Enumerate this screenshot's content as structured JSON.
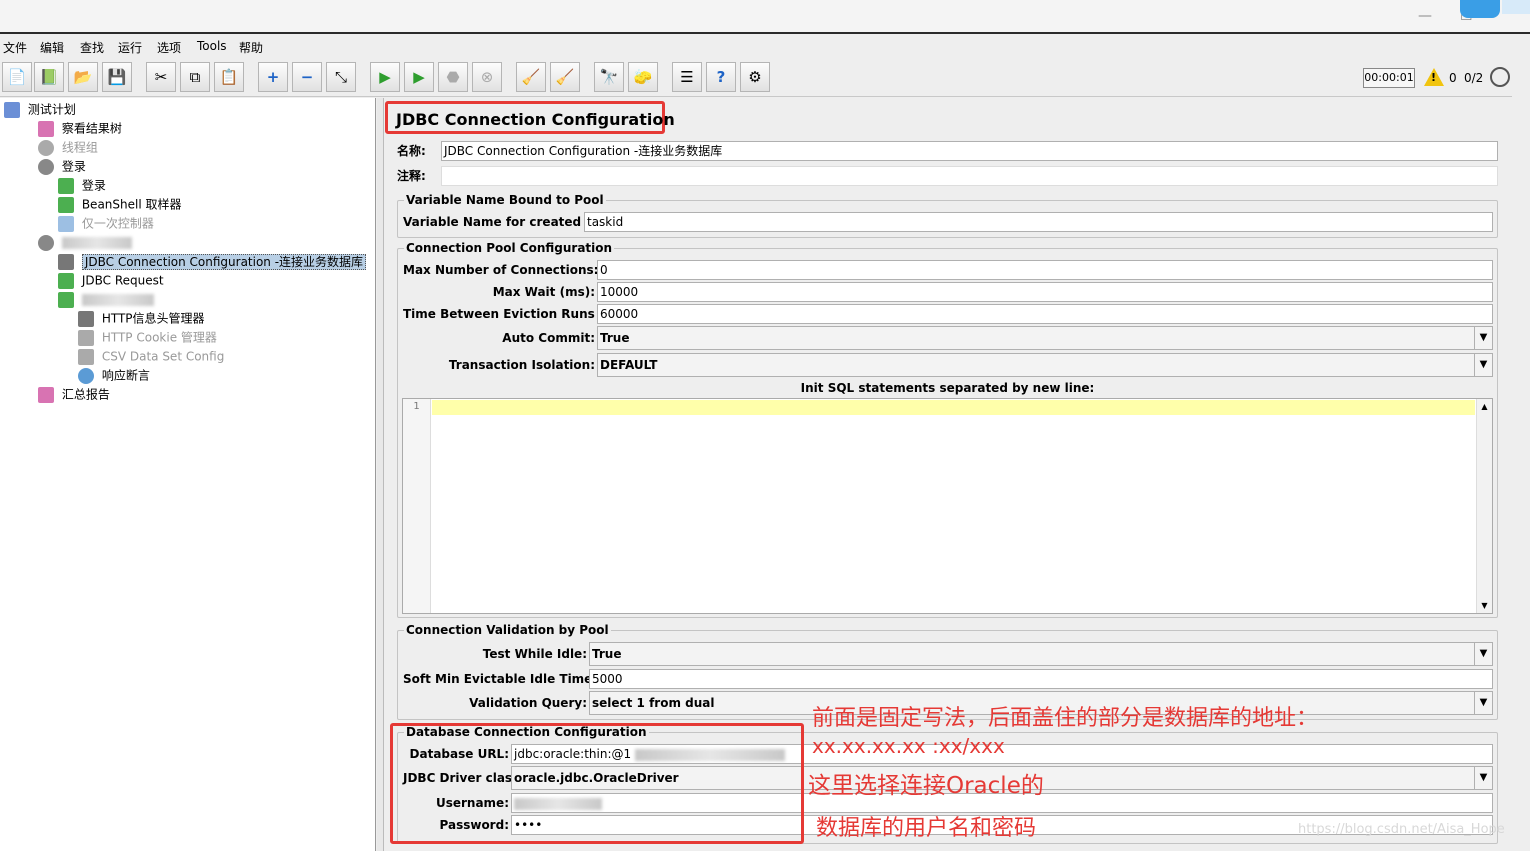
{
  "menu": [
    "文件",
    "编辑",
    "查找",
    "运行",
    "选项",
    "Tools",
    "帮助"
  ],
  "toolbar": {
    "icons": [
      "new-icon",
      "templates-icon",
      "open-icon",
      "save-icon",
      "cut-icon",
      "copy-icon",
      "paste-icon",
      "expand-icon",
      "collapse-icon",
      "toggle-icon",
      "start-icon",
      "start-no-pause-icon",
      "stop-icon",
      "shutdown-icon",
      "clear-icon",
      "clear-all-icon",
      "search-icon",
      "reset-search-icon",
      "function-helper-icon",
      "help-icon",
      "remote-icon"
    ],
    "timer": "00:00:01",
    "warning_count": "0",
    "threads": "0/2"
  },
  "tree": [
    {
      "label": "测试计划",
      "icon": "test-plan-icon",
      "color": "#6b8fd6"
    },
    {
      "label": "察看结果树",
      "icon": "graph-icon",
      "color": "#d873b2"
    },
    {
      "label": "线程组",
      "icon": "gear-icon",
      "color": "#888888",
      "disabled": true
    },
    {
      "label": "登录",
      "icon": "gear-icon",
      "color": "#888888"
    },
    {
      "label": "登录",
      "icon": "pipette-icon",
      "color": "#4caf50"
    },
    {
      "label": "BeanShell 取样器",
      "icon": "pipette-icon",
      "color": "#4caf50"
    },
    {
      "label": "仅一次控制器",
      "icon": "controller-icon",
      "color": "#5b9bd5",
      "disabled": true
    },
    {
      "label": "",
      "icon": "gear-icon",
      "color": "#888888",
      "hidden": true
    },
    {
      "label": "JDBC Connection Configuration -连接业务数据库",
      "icon": "tools-icon",
      "color": "#555555",
      "selected": true
    },
    {
      "label": "JDBC Request",
      "icon": "pipette-icon",
      "color": "#4caf50"
    },
    {
      "label": "",
      "icon": "pipette-icon",
      "color": "#4caf50",
      "hidden": true
    },
    {
      "label": "HTTP信息头管理器",
      "icon": "tools-icon",
      "color": "#555555"
    },
    {
      "label": "HTTP Cookie 管理器",
      "icon": "tools-icon",
      "color": "#555555",
      "disabled": true
    },
    {
      "label": "CSV Data Set Config",
      "icon": "tools-icon",
      "color": "#555555",
      "disabled": true
    },
    {
      "label": "响应断言",
      "icon": "magnifier-icon",
      "color": "#5b9bd5"
    },
    {
      "label": "汇总报告",
      "icon": "graph-icon",
      "color": "#d873b2"
    }
  ],
  "panel": {
    "title": "JDBC Connection Configuration",
    "name_label": "名称:",
    "name_value": "JDBC Connection Configuration -连接业务数据库",
    "comment_label": "注释:",
    "comment_value": "",
    "bound_group": "Variable Name Bound to Pool",
    "var_name_label": "Variable Name for created pool:",
    "var_name_value": "taskid",
    "pool_group": "Connection Pool Configuration",
    "max_conn_label": "Max Number of Connections:",
    "max_conn_value": "0",
    "max_wait_label": "Max Wait (ms):",
    "max_wait_value": "10000",
    "eviction_label": "Time Between Eviction Runs (ms):",
    "eviction_value": "60000",
    "auto_commit_label": "Auto Commit:",
    "auto_commit_value": "True",
    "isolation_label": "Transaction Isolation:",
    "isolation_value": "DEFAULT",
    "init_sql_label": "Init SQL statements separated by new line:",
    "line_number": "1",
    "validation_group": "Connection Validation by Pool",
    "test_idle_label": "Test While Idle:",
    "test_idle_value": "True",
    "soft_min_label": "Soft Min Evictable Idle Time(ms):",
    "soft_min_value": "5000",
    "validation_query_label": "Validation Query:",
    "validation_query_value": "select 1 from dual",
    "db_group": "Database Connection Configuration",
    "db_url_label": "Database URL:",
    "db_url_value": "jdbc:oracle:thin:@1",
    "driver_label": "JDBC Driver class:",
    "driver_value": "oracle.jdbc.OracleDriver",
    "username_label": "Username:",
    "password_label": "Password:",
    "password_value": "••••"
  },
  "annotations": {
    "line1": "前面是固定写法，后面盖住的部分是数据库的地址：",
    "line2": "xx.xx.xx.xx :xx/xxx",
    "line3": "这里选择连接Oracle的",
    "line4": "数据库的用户名和密码"
  },
  "watermark": "https://blog.csdn.net/Aisa_Hope",
  "colors": {
    "annotation_red": "#e53935",
    "selection": "#b8cfe5",
    "highlight_line": "#ffffaa"
  }
}
